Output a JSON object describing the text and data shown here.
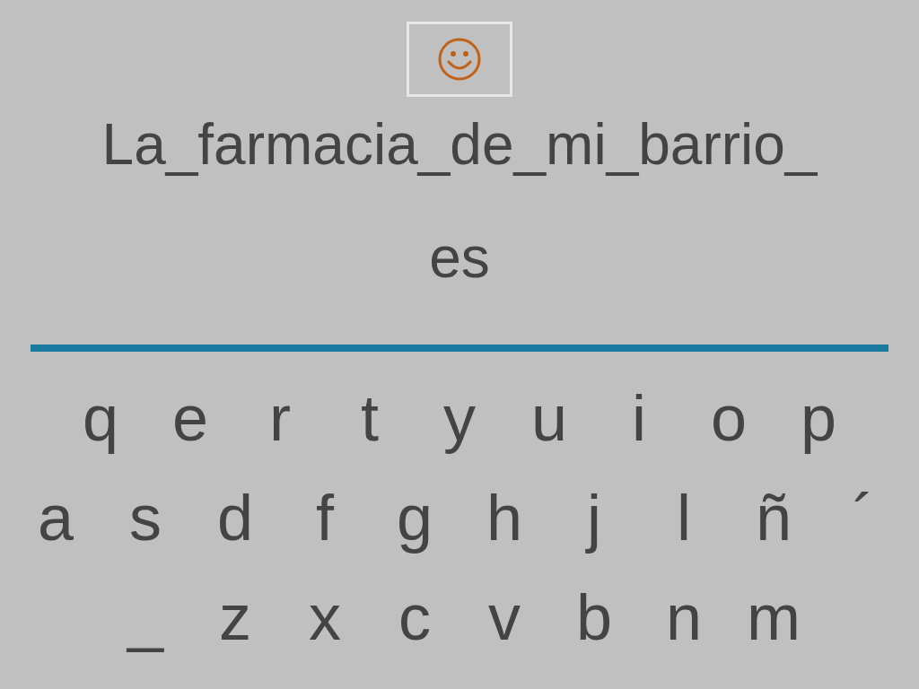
{
  "sentence_lines": [
    "La_farmacia_de_mi_barrio_",
    "es"
  ],
  "keyboard": [
    [
      "q",
      "e",
      "r",
      "t",
      "y",
      "u",
      "i",
      "o",
      "p"
    ],
    [
      "a",
      "s",
      "d",
      "f",
      "g",
      "h",
      "j",
      "l",
      "ñ",
      "´"
    ],
    [
      "_",
      "z",
      "x",
      "c",
      "v",
      "b",
      "n",
      "m"
    ]
  ]
}
